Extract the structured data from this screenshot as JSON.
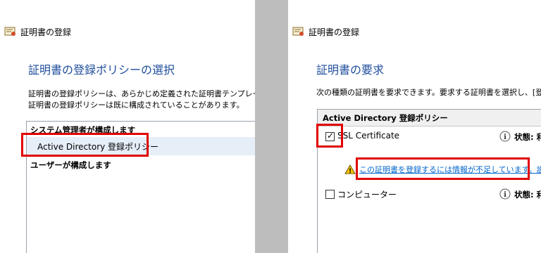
{
  "left": {
    "title": "証明書の登録",
    "heading": "証明書の登録ポリシーの選択",
    "description": [
      "証明書の登録ポリシーは、あらかじめ定義された証明書テンプレートに",
      "証明書の登録ポリシーは既に構成されていることがあります。"
    ],
    "group_admin": "システム管理者が構成します",
    "selected_policy": "Active Directory 登録ポリシー",
    "group_user": "ユーザーが構成します"
  },
  "right": {
    "title": "証明書の登録",
    "heading": "証明書の要求",
    "description": "次の種類の証明書を要求できます。要求する証明書を選択し、[登",
    "group_header": "Active Directory 登録ポリシー",
    "items": [
      {
        "label": "SSL Certificate",
        "checked": true,
        "status_label": "状態:",
        "status_value": "利"
      },
      {
        "label": "コンピューター",
        "checked": false,
        "status_label": "状態:",
        "status_value": "利"
      }
    ],
    "warning_link": "この証明書を登録するには情報が不足しています。",
    "warning_link_more": "設定"
  },
  "colors": {
    "heading": "#1f4e9c",
    "link": "#0066cc",
    "highlight": "#e00000",
    "selection": "#e6eef8"
  },
  "icons": [
    "certificate-icon",
    "info-icon",
    "warning-icon",
    "checkmark-icon"
  ]
}
